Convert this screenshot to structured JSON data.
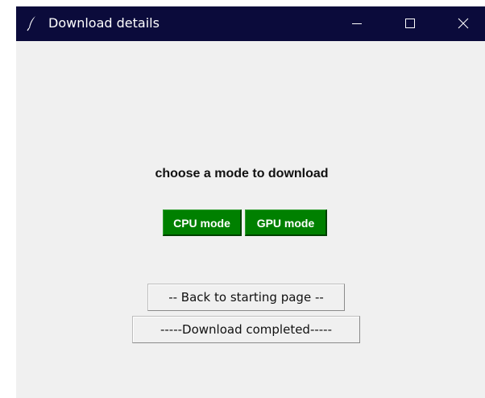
{
  "window": {
    "title": "Download details",
    "controls": {
      "minimize": "minimize",
      "maximize": "maximize",
      "close": "close"
    }
  },
  "main": {
    "heading": "choose a mode to download",
    "cpu_button_label": "CPU mode",
    "gpu_button_label": "GPU mode",
    "back_button_label": "--  Back to starting page --",
    "completed_button_label": "-----Download completed-----"
  },
  "icons": {
    "app": "feather-icon",
    "minimize": "minimize-icon",
    "maximize": "maximize-icon",
    "close": "close-icon"
  },
  "colors": {
    "titlebar": "#0b0b3b",
    "window_background": "#f0f0f0",
    "mode_button": "#008000",
    "mode_button_text": "#ffffff"
  }
}
